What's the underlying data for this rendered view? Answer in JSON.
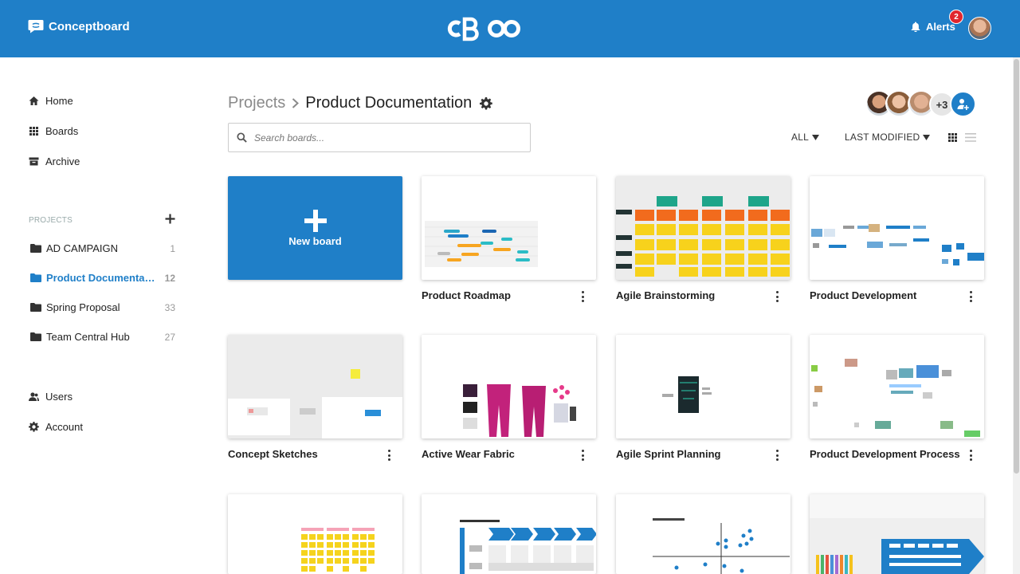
{
  "header": {
    "brand_name": "Conceptboard",
    "alerts_label": "Alerts",
    "alerts_count": "2"
  },
  "sidebar": {
    "nav": [
      {
        "label": "Home",
        "icon": "home-icon"
      },
      {
        "label": "Boards",
        "icon": "grid-icon"
      },
      {
        "label": "Archive",
        "icon": "archive-icon"
      }
    ],
    "projects_heading": "PROJECTS",
    "projects": [
      {
        "name": "AD CAMPAIGN",
        "count": "1"
      },
      {
        "name": "Product Documentation",
        "count": "12",
        "active": true
      },
      {
        "name": "Spring Proposal",
        "count": "33"
      },
      {
        "name": "Team Central Hub",
        "count": "27"
      }
    ],
    "bottom_nav": [
      {
        "label": "Users",
        "icon": "users-icon"
      },
      {
        "label": "Account",
        "icon": "gear-icon"
      }
    ]
  },
  "main": {
    "breadcrumb_root": "Projects",
    "breadcrumb_current": "Product Documentation",
    "search_placeholder": "Search boards...",
    "members_more": "+3",
    "filter_all": "ALL",
    "sort_label": "LAST MODIFIED",
    "new_board_label": "New board",
    "boards": [
      {
        "title": "Product Roadmap"
      },
      {
        "title": "Agile Brainstorming"
      },
      {
        "title": "Product Development"
      },
      {
        "title": "Concept Sketches"
      },
      {
        "title": "Active Wear Fabric"
      },
      {
        "title": "Agile Sprint Planning"
      },
      {
        "title": "Product Development Process"
      }
    ]
  },
  "colors": {
    "brand_blue": "#1f7fc8",
    "alert_red": "#e0262e"
  }
}
